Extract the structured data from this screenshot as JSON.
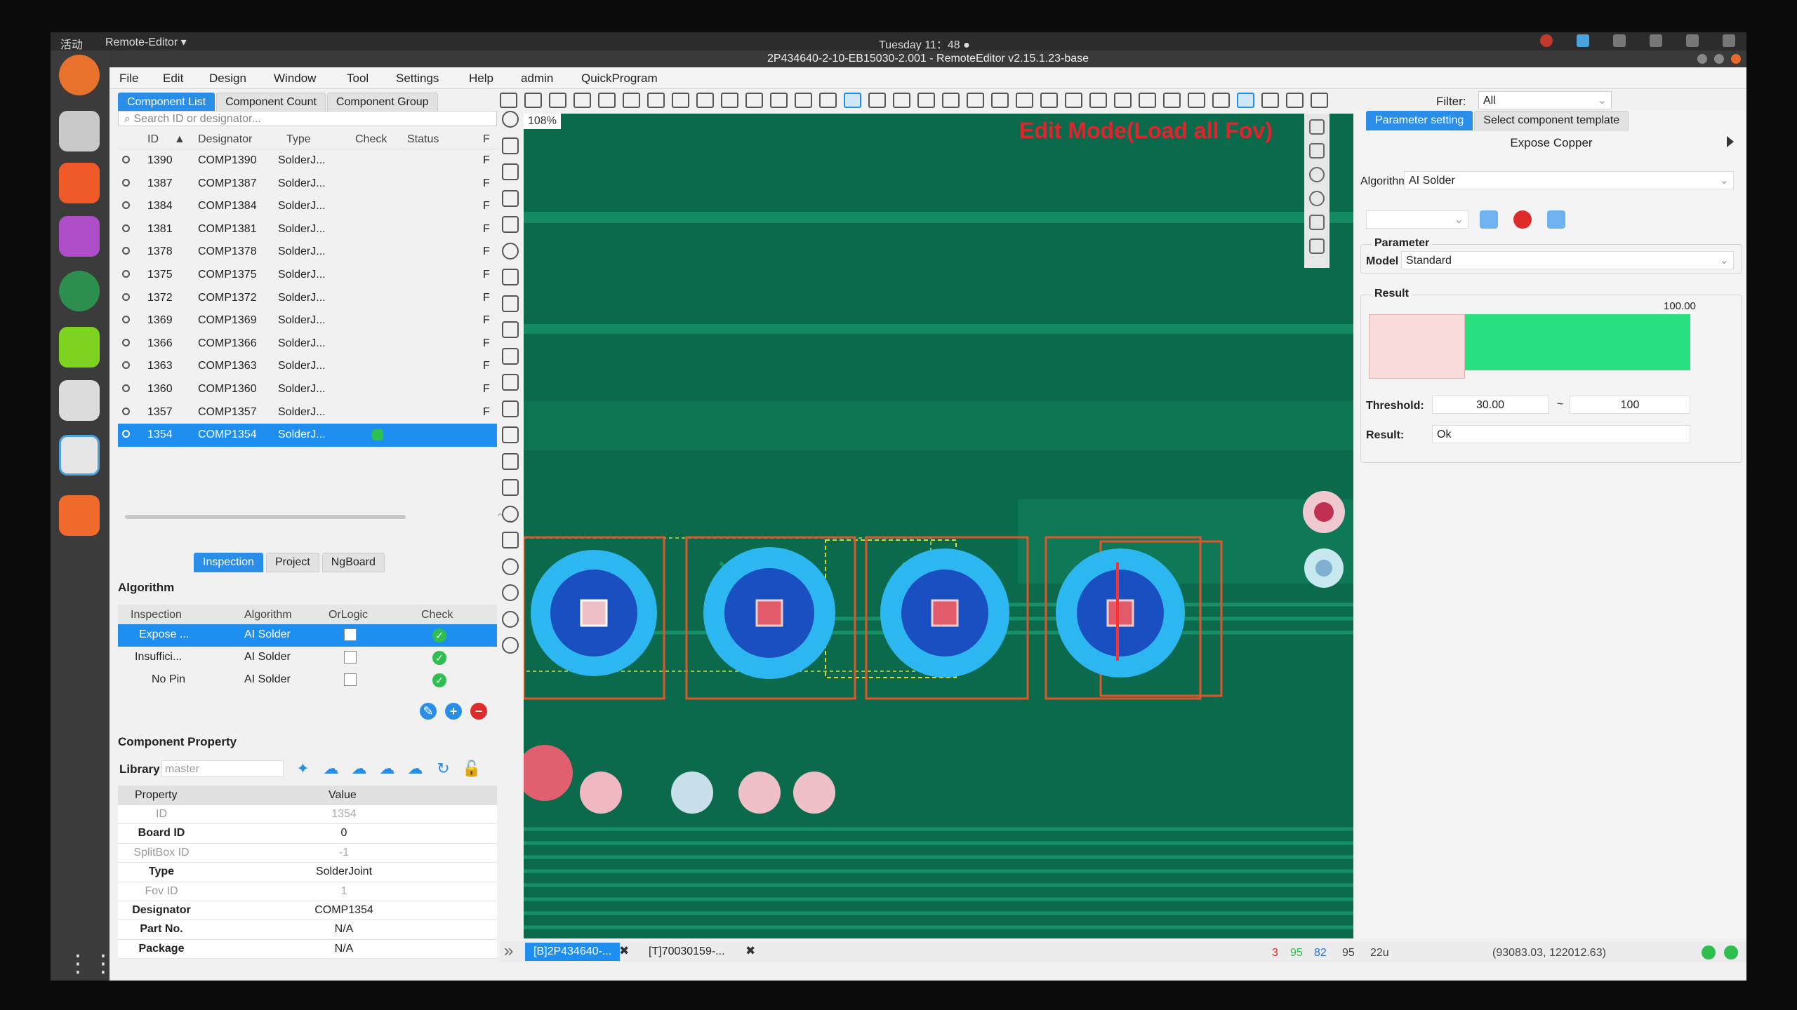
{
  "topbar": {
    "activities": "活动",
    "app": "Remote-Editor ▾",
    "clock": "Tuesday 11：48 ●"
  },
  "window": {
    "title": "2P434640-2-10-EB15030-2.001 - RemoteEditor v2.15.1.23-base"
  },
  "menu": [
    "File",
    "Edit",
    "Design",
    "Window",
    "Tool",
    "Settings",
    "Help",
    "admin",
    "QuickProgram"
  ],
  "left_tabs": [
    "Component List",
    "Component Count",
    "Component Group"
  ],
  "search": {
    "placeholder": "Search ID or designator..."
  },
  "component_list": {
    "headers": [
      "ID",
      "Designator",
      "Type",
      "Check",
      "Status",
      "F"
    ],
    "rows": [
      {
        "id": "1390",
        "designator": "COMP1390",
        "type": "SolderJ...",
        "flag": "F"
      },
      {
        "id": "1387",
        "designator": "COMP1387",
        "type": "SolderJ...",
        "flag": "F"
      },
      {
        "id": "1384",
        "designator": "COMP1384",
        "type": "SolderJ...",
        "flag": "F"
      },
      {
        "id": "1381",
        "designator": "COMP1381",
        "type": "SolderJ...",
        "flag": "F"
      },
      {
        "id": "1378",
        "designator": "COMP1378",
        "type": "SolderJ...",
        "flag": "F"
      },
      {
        "id": "1375",
        "designator": "COMP1375",
        "type": "SolderJ...",
        "flag": "F"
      },
      {
        "id": "1372",
        "designator": "COMP1372",
        "type": "SolderJ...",
        "flag": "F"
      },
      {
        "id": "1369",
        "designator": "COMP1369",
        "type": "SolderJ...",
        "flag": "F"
      },
      {
        "id": "1366",
        "designator": "COMP1366",
        "type": "SolderJ...",
        "flag": "F"
      },
      {
        "id": "1363",
        "designator": "COMP1363",
        "type": "SolderJ...",
        "flag": "F"
      },
      {
        "id": "1360",
        "designator": "COMP1360",
        "type": "SolderJ...",
        "flag": "F"
      },
      {
        "id": "1357",
        "designator": "COMP1357",
        "type": "SolderJ...",
        "flag": "F"
      },
      {
        "id": "1354",
        "designator": "COMP1354",
        "type": "SolderJ...",
        "flag": ""
      }
    ]
  },
  "mid_tabs": [
    "Inspection",
    "Project",
    "NgBoard"
  ],
  "algorithm": {
    "title": "Algorithm",
    "headers": [
      "Inspection",
      "Algorithm",
      "OrLogic",
      "Check"
    ],
    "rows": [
      {
        "inspection": "Expose ...",
        "algorithm": "AI Solder"
      },
      {
        "inspection": "Insuffici...",
        "algorithm": "AI Solder"
      },
      {
        "inspection": "No Pin",
        "algorithm": "AI Solder"
      }
    ]
  },
  "component_property": {
    "title": "Component Property",
    "library_label": "Library",
    "library_value": "master",
    "headers": [
      "Property",
      "Value"
    ],
    "rows": [
      {
        "k": "ID",
        "v": "1354"
      },
      {
        "k": "Board ID",
        "v": "0"
      },
      {
        "k": "SplitBox ID",
        "v": "-1"
      },
      {
        "k": "Type",
        "v": "SolderJoint"
      },
      {
        "k": "Fov ID",
        "v": "1"
      },
      {
        "k": "Designator",
        "v": "COMP1354"
      },
      {
        "k": "Part No.",
        "v": "N/A"
      },
      {
        "k": "Package",
        "v": "N/A"
      }
    ]
  },
  "toolbar": {
    "filter_label": "Filter:",
    "filter_value": "All"
  },
  "canvas": {
    "zoom": "108%",
    "mode_text": "Edit Mode(Load all Fov)"
  },
  "bottom": {
    "tabs": [
      "[B]2P434640-...",
      "[T]70030159-..."
    ],
    "stats": [
      "3",
      "95",
      "82",
      "95",
      "22u"
    ],
    "coords": "(93083.03, 122012.63)"
  },
  "right_panel": {
    "tabs": [
      "Parameter setting",
      "Select component template"
    ],
    "heading": "Expose Copper",
    "algorithm_label": "Algorithm:",
    "algorithm_value": "AI Solder",
    "parameter_title": "Parameter",
    "model_label": "Model",
    "model_value": "Standard",
    "result_title": "Result",
    "result_score": "100.00",
    "result_fraction": 0.3,
    "threshold_label": "Threshold:",
    "threshold_low": "30.00",
    "threshold_sep": "~",
    "threshold_high": "100",
    "result_label": "Result:",
    "result_value": "Ok"
  },
  "colors": {
    "accent": "#1e8ef0",
    "board": "#0d6a4c",
    "ok": "#2fbf51",
    "edit_mode": "#e0242c"
  }
}
